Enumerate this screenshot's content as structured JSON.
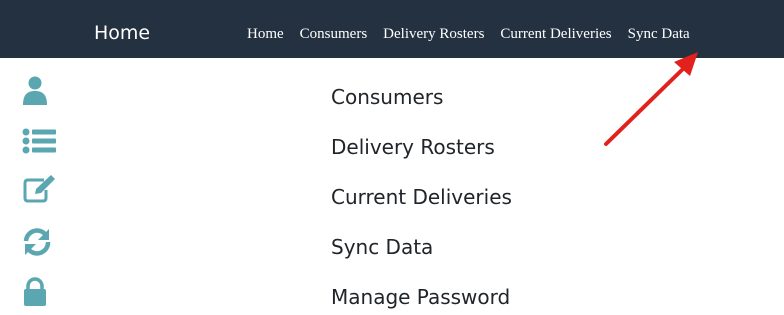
{
  "navbar": {
    "brand": "Home",
    "links": [
      {
        "label": "Home"
      },
      {
        "label": "Consumers"
      },
      {
        "label": "Delivery Rosters"
      },
      {
        "label": "Current Deliveries"
      },
      {
        "label": "Sync Data"
      }
    ]
  },
  "menu": {
    "items": [
      {
        "label": "Consumers",
        "icon": "user-icon"
      },
      {
        "label": "Delivery Rosters",
        "icon": "list-icon"
      },
      {
        "label": "Current Deliveries",
        "icon": "edit-icon"
      },
      {
        "label": "Sync Data",
        "icon": "sync-icon"
      },
      {
        "label": "Manage Password",
        "icon": "lock-icon"
      }
    ]
  },
  "colors": {
    "navbar_bg": "#233140",
    "icon_teal": "#5aa6b1",
    "annotation_arrow": "#e3211c"
  }
}
